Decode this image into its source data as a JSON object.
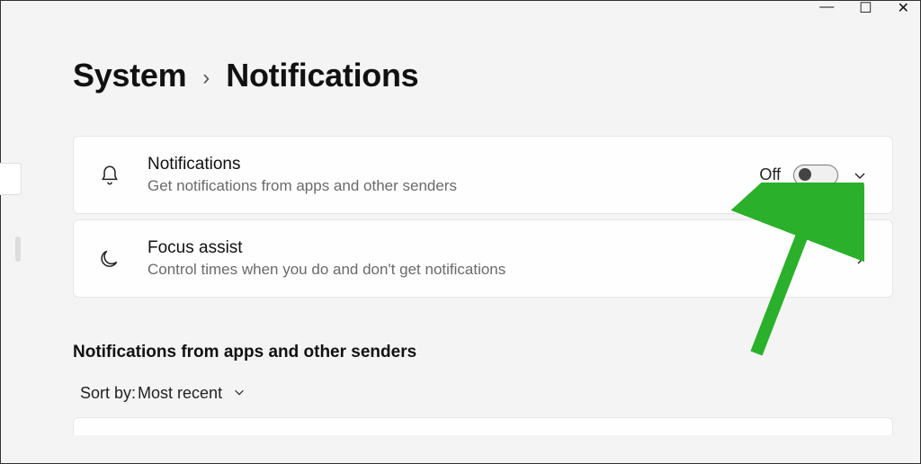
{
  "window": {
    "minimize": "—",
    "maximize": "☐",
    "close": "✕"
  },
  "breadcrumb": {
    "parent": "System",
    "separator": "›",
    "current": "Notifications"
  },
  "cards": {
    "notifications": {
      "title": "Notifications",
      "subtitle": "Get notifications from apps and other senders",
      "toggle_label": "Off",
      "toggle_state": "off"
    },
    "focus_assist": {
      "title": "Focus assist",
      "subtitle": "Control times when you do and don't get notifications"
    }
  },
  "section": {
    "heading": "Notifications from apps and other senders",
    "sort_label": "Sort by: ",
    "sort_value": "Most recent"
  }
}
